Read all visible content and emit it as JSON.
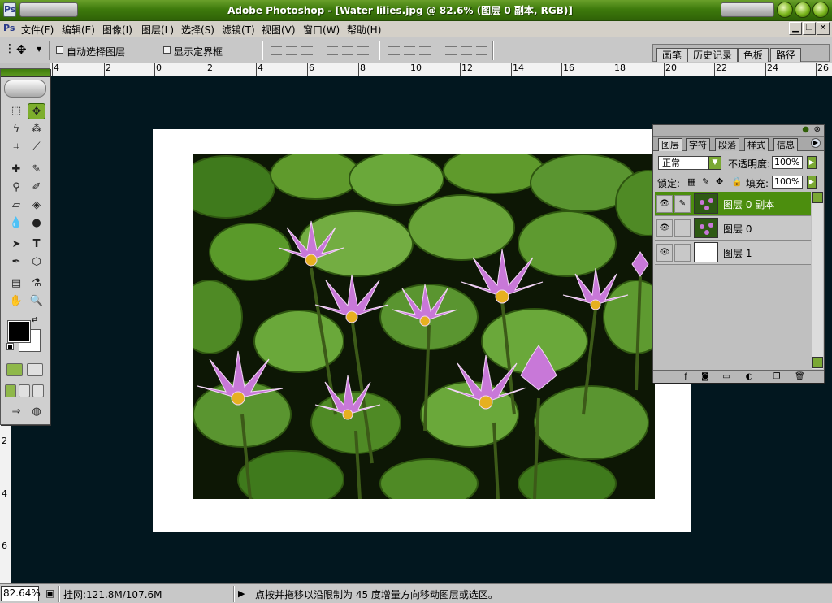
{
  "titlebar": {
    "title": "Adobe Photoshop - [Water lilies.jpg @ 82.6% (图层 0 副本, RGB)]"
  },
  "menubar": {
    "items": [
      "文件(F)",
      "编辑(E)",
      "图像(I)",
      "图层(L)",
      "选择(S)",
      "滤镜(T)",
      "视图(V)",
      "窗口(W)",
      "帮助(H)"
    ]
  },
  "options": {
    "auto_select": "自动选择图层",
    "show_bounds": "显示定界框"
  },
  "palette_well": {
    "tabs": [
      "画笔",
      "历史记录",
      "色板",
      "路径"
    ]
  },
  "ruler": {
    "h_labels": [
      "4",
      "2",
      "0",
      "2",
      "4",
      "6",
      "8",
      "10",
      "12",
      "14",
      "16",
      "18",
      "20",
      "22",
      "24",
      "26"
    ],
    "v_labels": [
      "2",
      "4",
      "6"
    ]
  },
  "layers_panel": {
    "tabs": [
      "图层",
      "字符",
      "段落",
      "样式",
      "信息"
    ],
    "blend_mode": "正常",
    "opacity_label": "不透明度:",
    "opacity_value": "100%",
    "lock_label": "锁定:",
    "fill_label": "填充:",
    "fill_value": "100%",
    "layers": [
      {
        "name": "图层 0 副本",
        "selected": true
      },
      {
        "name": "图层 0",
        "selected": false
      },
      {
        "name": "图层 1",
        "selected": false
      }
    ]
  },
  "statusbar": {
    "zoom": "82.64%",
    "doc_size": "挂网:121.8M/107.6M",
    "hint": "点按并拖移以沿限制为 45 度增量方向移动图层或选区。"
  },
  "colors": {
    "accent_green": "#4c8e0e",
    "canvas_bg": "#02171f"
  }
}
